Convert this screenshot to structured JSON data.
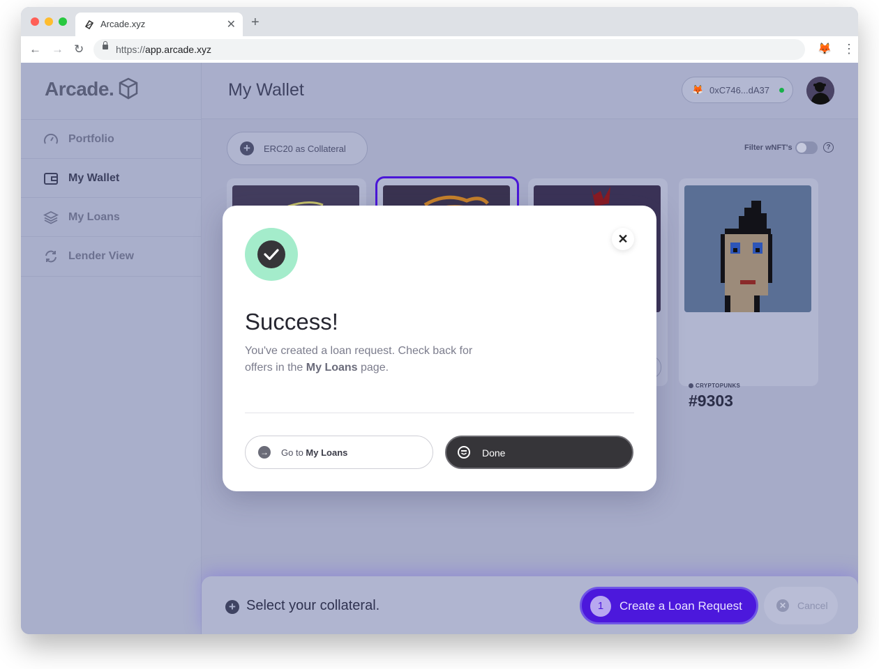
{
  "browser": {
    "tab_title": "Arcade.xyz",
    "url_protocol": "https://",
    "url_host": "app.arcade.xyz"
  },
  "sidebar": {
    "logo": "Arcade.",
    "items": [
      {
        "label": "Portfolio",
        "icon": "gauge-icon"
      },
      {
        "label": "My Wallet",
        "icon": "wallet-icon",
        "active": true
      },
      {
        "label": "My Loans",
        "icon": "layers-icon"
      },
      {
        "label": "Lender View",
        "icon": "refresh-icon"
      }
    ]
  },
  "header": {
    "title": "My Wallet",
    "wallet_address": "0xC746...dA37",
    "wallet_status_color": "#18b04a"
  },
  "toolbar": {
    "erc20_label": "ERC20 as Collateral",
    "filter_label": "Filter wNFT's"
  },
  "nft": {
    "collection": "CRYPTOPUNKS",
    "id": "#9303"
  },
  "bottom_bar": {
    "prompt": "Select your collateral.",
    "step_number": "1",
    "create_label": "Create a Loan Request",
    "cancel_label": "Cancel"
  },
  "modal": {
    "title": "Success!",
    "message_part1": "You've created a loan request. Check back for offers in the ",
    "message_bold": "My Loans",
    "message_part2": " page.",
    "goto_prefix": "Go to ",
    "goto_bold": "My Loans",
    "done_label": "Done"
  },
  "colors": {
    "accent": "#4c18dc",
    "success": "#a4eccb",
    "dark_button": "#363539"
  }
}
